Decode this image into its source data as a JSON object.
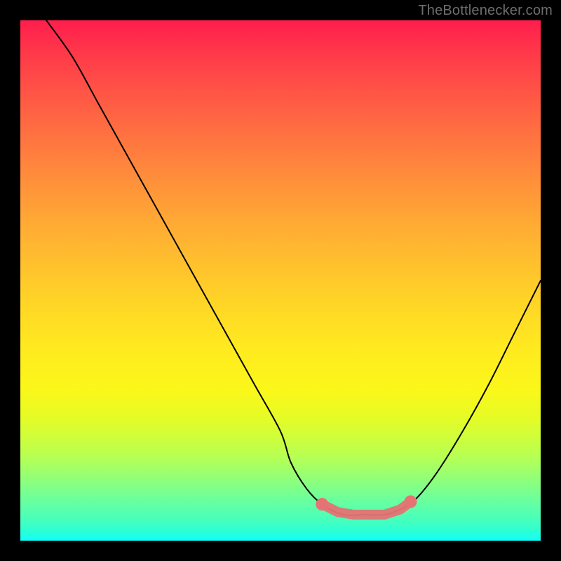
{
  "attribution": {
    "text": "TheBottlenecker.com"
  },
  "colors": {
    "curve_stroke": "#000000",
    "marker_fill": "#e57373",
    "background_black": "#000000"
  },
  "chart_data": {
    "type": "line",
    "title": "",
    "xlabel": "",
    "ylabel": "",
    "xlim": [
      0,
      100
    ],
    "ylim": [
      0,
      100
    ],
    "series": [
      {
        "name": "bottleneck-curve",
        "x": [
          5,
          10,
          15,
          20,
          25,
          30,
          35,
          40,
          45,
          50,
          52,
          55,
          58,
          62,
          66,
          70,
          73,
          76,
          80,
          85,
          90,
          95,
          100
        ],
        "y": [
          100,
          93,
          84,
          75,
          66,
          57,
          48,
          39,
          30,
          21,
          15,
          10,
          7,
          5,
          5,
          5,
          6,
          8,
          13,
          21,
          30,
          40,
          50
        ]
      }
    ],
    "annotations": [
      {
        "name": "valley-highlight",
        "points": [
          {
            "x": 58,
            "y": 7
          },
          {
            "x": 61,
            "y": 5.5
          },
          {
            "x": 64,
            "y": 5
          },
          {
            "x": 67,
            "y": 5
          },
          {
            "x": 70,
            "y": 5
          },
          {
            "x": 73,
            "y": 6
          },
          {
            "x": 75,
            "y": 7.5
          }
        ]
      }
    ]
  }
}
